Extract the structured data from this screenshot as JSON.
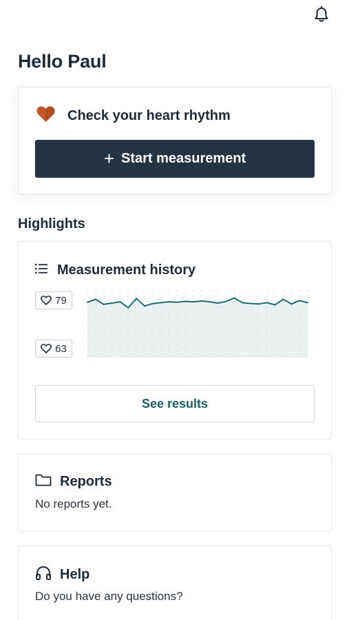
{
  "header": {
    "notifications_icon": "bell-icon",
    "greeting": "Hello Paul"
  },
  "measure_card": {
    "icon": "heart-icon",
    "icon_color": "#c4552a",
    "title": "Check your heart rhythm",
    "button_icon": "plus-icon",
    "button_label": "Start measurement"
  },
  "highlights": {
    "title": "Highlights",
    "history": {
      "icon": "list-icon",
      "title": "Measurement history",
      "max_label": "79",
      "min_label": "63",
      "see_results_label": "See results"
    }
  },
  "chart_data": {
    "type": "area",
    "title": "",
    "xlabel": "",
    "ylabel": "",
    "ylim": [
      63,
      79
    ],
    "grid": true,
    "line_color": "#1d6b70",
    "fill_color": "#e4eceb",
    "series": [
      {
        "values": [
          76.1,
          76.8,
          75.6,
          75.9,
          76.2,
          74.8,
          77.0,
          75.2,
          75.8,
          76.0,
          76.2,
          76.1,
          76.3,
          76.2,
          76.4,
          76.2,
          75.9,
          76.3,
          77.1,
          76.0,
          75.8,
          75.7,
          76.0,
          75.5,
          76.8,
          75.7,
          76.5,
          76.0
        ]
      }
    ]
  },
  "reports": {
    "icon": "folder-icon",
    "title": "Reports",
    "text": "No reports yet."
  },
  "help": {
    "icon": "headphones-icon",
    "title": "Help",
    "text": "Do you have any questions?"
  }
}
